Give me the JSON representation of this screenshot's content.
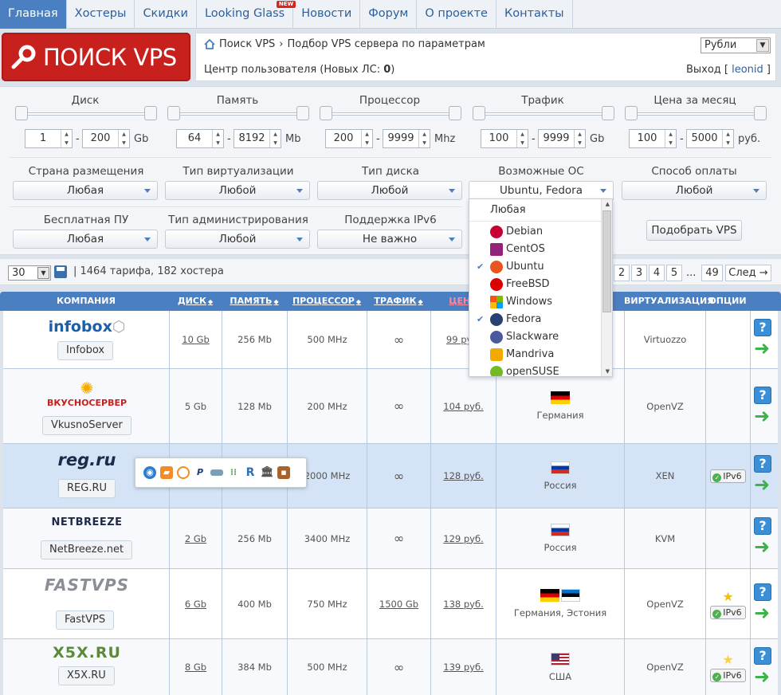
{
  "nav": {
    "items": [
      "Главная",
      "Хостеры",
      "Скидки",
      "Looking Glass",
      "Новости",
      "Форум",
      "О проекте",
      "Контакты"
    ],
    "new_badge": "NEW"
  },
  "logo": {
    "text": "ПОИСК VPS"
  },
  "header": {
    "breadcrumb": [
      "Поиск VPS",
      "Подбор VPS сервера по параметрам"
    ],
    "currency": "Рубли",
    "user_center_prefix": "Центр пользователя (Новых ЛС: ",
    "new_messages": "0",
    "user_center_suffix": ")",
    "logout_prefix": "Выход [ ",
    "username": "leonid",
    "logout_suffix": " ]"
  },
  "sliders": [
    {
      "label": "Диск",
      "min": "1",
      "max": "200",
      "unit": "Gb"
    },
    {
      "label": "Память",
      "min": "64",
      "max": "8192",
      "unit": "Mb"
    },
    {
      "label": "Процессор",
      "min": "200",
      "max": "9999",
      "unit": "Mhz"
    },
    {
      "label": "Трафик",
      "min": "100",
      "max": "9999",
      "unit": "Gb"
    },
    {
      "label": "Цена за месяц",
      "min": "100",
      "max": "5000",
      "unit": "руб."
    }
  ],
  "selects_row1": [
    {
      "label": "Страна размещения",
      "value": "Любая"
    },
    {
      "label": "Тип виртуализации",
      "value": "Любой"
    },
    {
      "label": "Тип диска",
      "value": "Любой"
    },
    {
      "label": "Возможные ОС",
      "value": "Ubuntu, Fedora"
    },
    {
      "label": "Способ оплаты",
      "value": "Любой"
    }
  ],
  "selects_row2": [
    {
      "label": "Бесплатная ПУ",
      "value": "Любая"
    },
    {
      "label": "Тип администрирования",
      "value": "Любой"
    },
    {
      "label": "Поддержка IPv6",
      "value": "Не важно"
    }
  ],
  "find_button": "Подобрать VPS",
  "os_dropdown": {
    "any": "Любая",
    "options": [
      {
        "name": "Debian",
        "checked": false,
        "color": "#c70036"
      },
      {
        "name": "CentOS",
        "checked": false,
        "color": "#932279"
      },
      {
        "name": "Ubuntu",
        "checked": true,
        "color": "#e95420"
      },
      {
        "name": "FreeBSD",
        "checked": false,
        "color": "#d00"
      },
      {
        "name": "Windows",
        "checked": false,
        "color": "#0a7bd6"
      },
      {
        "name": "Fedora",
        "checked": true,
        "color": "#294172"
      },
      {
        "name": "Slackware",
        "checked": false,
        "color": "#4b5a9c"
      },
      {
        "name": "Mandriva",
        "checked": false,
        "color": "#f2a900"
      },
      {
        "name": "openSUSE",
        "checked": false,
        "color": "#73ba25"
      }
    ]
  },
  "pager": {
    "per_page": "30",
    "summary": "| 1464 тарифа, 182 хостера",
    "pages": [
      "2",
      "3",
      "4",
      "5"
    ],
    "ellipsis": "...",
    "last": "49",
    "next": "След →"
  },
  "table": {
    "headers": {
      "company": "КОМПАНИЯ",
      "disk": "ДИСК",
      "memory": "ПАМЯТЬ",
      "cpu": "ПРОЦЕССОР",
      "traffic": "ТРАФИК",
      "price": "ЦЕНА",
      "virt": "ВИРТУАЛИЗАЦИЯ",
      "options": "ОПЦИИ"
    },
    "rows": [
      {
        "logo": "infobox",
        "name": "Infobox",
        "disk": "10 Gb",
        "mem": "256 Mb",
        "cpu": "500 MHz",
        "traffic": "∞",
        "price": "99 руб.",
        "country": "",
        "virt": "Virtuozzo"
      },
      {
        "logo": "ВКУСНОСЕРВЕР",
        "name": "VkusnoServer",
        "disk": "5 Gb",
        "mem": "128 Mb",
        "cpu": "200 MHz",
        "traffic": "∞",
        "price": "104 руб.",
        "country": "Германия",
        "virt": "OpenVZ"
      },
      {
        "logo": "reg.ru",
        "name": "REG.RU",
        "disk": "",
        "mem": "",
        "cpu": "2000 MHz",
        "traffic": "∞",
        "price": "128 руб.",
        "country": "Россия",
        "virt": "XEN"
      },
      {
        "logo": "NETBREEZE",
        "name": "NetBreeze.net",
        "disk": "2 Gb",
        "mem": "256 Mb",
        "cpu": "3400 MHz",
        "traffic": "∞",
        "price": "129 руб.",
        "country": "Россия",
        "virt": "KVM"
      },
      {
        "logo": "FASTVPS",
        "name": "FastVPS",
        "disk": "6 Gb",
        "mem": "400 Mb",
        "cpu": "750 MHz",
        "traffic": "1500 Gb",
        "price": "138 руб.",
        "country": "Германия, Эстония",
        "virt": "OpenVZ"
      },
      {
        "logo": "X5X.RU",
        "name": "X5X.RU",
        "disk": "8 Gb",
        "mem": "384 Mb",
        "cpu": "500 MHz",
        "traffic": "∞",
        "price": "139 руб.",
        "country": "США",
        "virt": "OpenVZ"
      }
    ],
    "ipv6_label": "IPv6",
    "help": "?"
  }
}
